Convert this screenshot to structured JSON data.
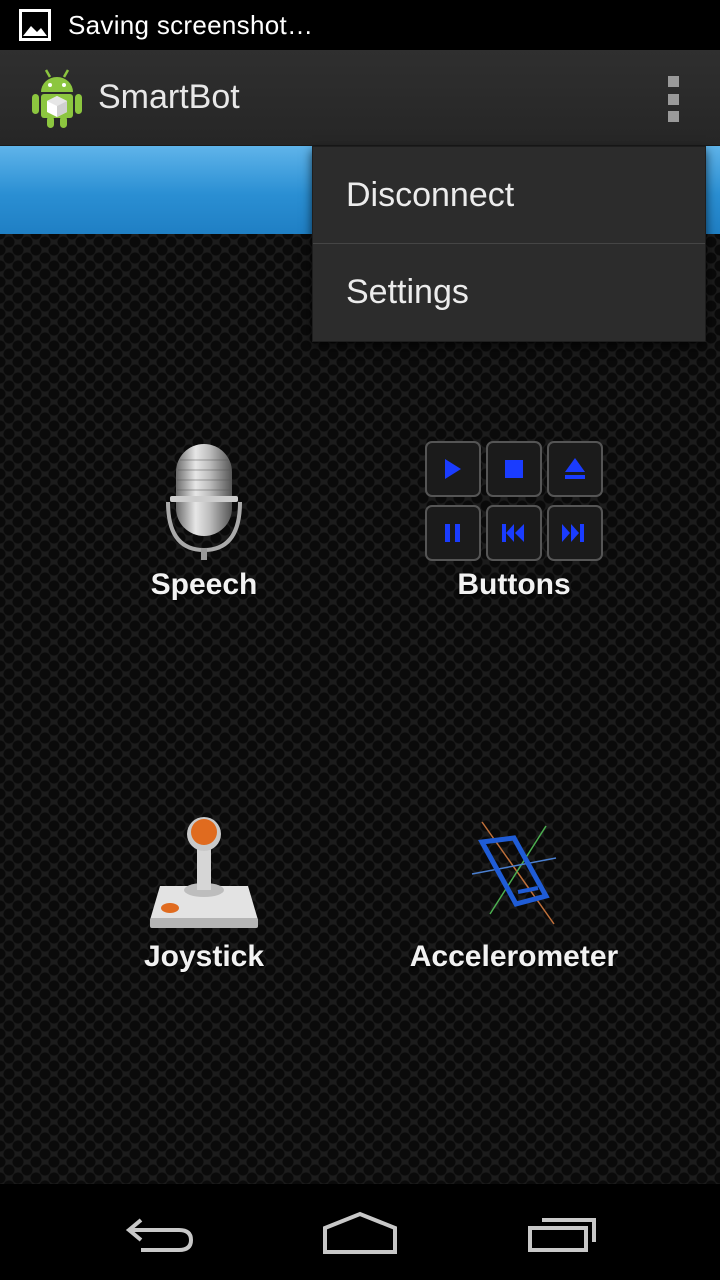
{
  "status_bar": {
    "text": "Saving screenshot…",
    "icon": "image-icon"
  },
  "action_bar": {
    "title": "SmartBot",
    "app_icon": "android-robot-icon",
    "overflow_icon": "overflow-menu-icon"
  },
  "tiles": [
    {
      "label": "Speech",
      "icon": "microphone-icon"
    },
    {
      "label": "Buttons",
      "icon": "media-buttons-icon"
    },
    {
      "label": "Joystick",
      "icon": "joystick-icon"
    },
    {
      "label": "Accelerometer",
      "icon": "accelerometer-icon"
    }
  ],
  "menu": {
    "items": [
      {
        "label": "Disconnect"
      },
      {
        "label": "Settings"
      }
    ]
  },
  "nav_bar": {
    "back_icon": "back-icon",
    "home_icon": "home-icon",
    "recents_icon": "recents-icon"
  },
  "colors": {
    "accent_blue": "#2a8fd3",
    "menu_bg": "#2c2c2c",
    "media_button_blue": "#1a3cff"
  }
}
